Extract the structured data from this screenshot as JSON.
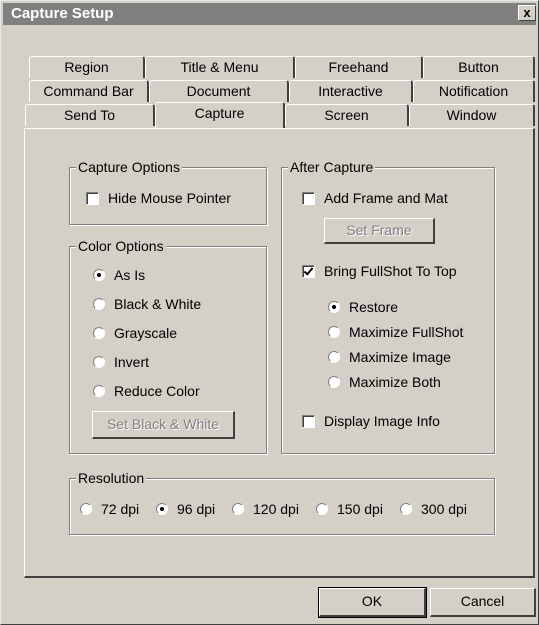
{
  "window": {
    "title": "Capture Setup",
    "close_label": "x"
  },
  "tabs": {
    "row1": [
      "Region",
      "Title & Menu",
      "Freehand",
      "Button"
    ],
    "row2": [
      "Command Bar",
      "Document",
      "Interactive",
      "Notification"
    ],
    "row3": [
      "Send To",
      "Capture",
      "Screen",
      "Window"
    ],
    "active": "Capture"
  },
  "capture_options": {
    "label": "Capture Options",
    "hide_mouse_pointer": {
      "label": "Hide Mouse Pointer",
      "checked": false
    }
  },
  "color_options": {
    "label": "Color Options",
    "items": [
      {
        "label": "As Is",
        "checked": true
      },
      {
        "label": "Black & White",
        "checked": false
      },
      {
        "label": "Grayscale",
        "checked": false
      },
      {
        "label": "Invert",
        "checked": false
      },
      {
        "label": "Reduce Color",
        "checked": false
      }
    ],
    "button": "Set Black & White"
  },
  "after_capture": {
    "label": "After Capture",
    "add_frame": {
      "label": "Add Frame and Mat",
      "checked": false
    },
    "set_frame_button": "Set Frame",
    "bring_to_top": {
      "label": "Bring FullShot To Top",
      "checked": true
    },
    "options": [
      {
        "label": "Restore",
        "checked": true
      },
      {
        "label": "Maximize FullShot",
        "checked": false
      },
      {
        "label": "Maximize Image",
        "checked": false
      },
      {
        "label": "Maximize Both",
        "checked": false
      }
    ],
    "display_info": {
      "label": "Display Image Info",
      "checked": false
    }
  },
  "resolution": {
    "label": "Resolution",
    "options": [
      {
        "label": "72 dpi",
        "checked": false
      },
      {
        "label": "96 dpi",
        "checked": true
      },
      {
        "label": "120 dpi",
        "checked": false
      },
      {
        "label": "150 dpi",
        "checked": false
      },
      {
        "label": "300 dpi",
        "checked": false
      }
    ]
  },
  "buttons": {
    "ok": "OK",
    "cancel": "Cancel"
  }
}
